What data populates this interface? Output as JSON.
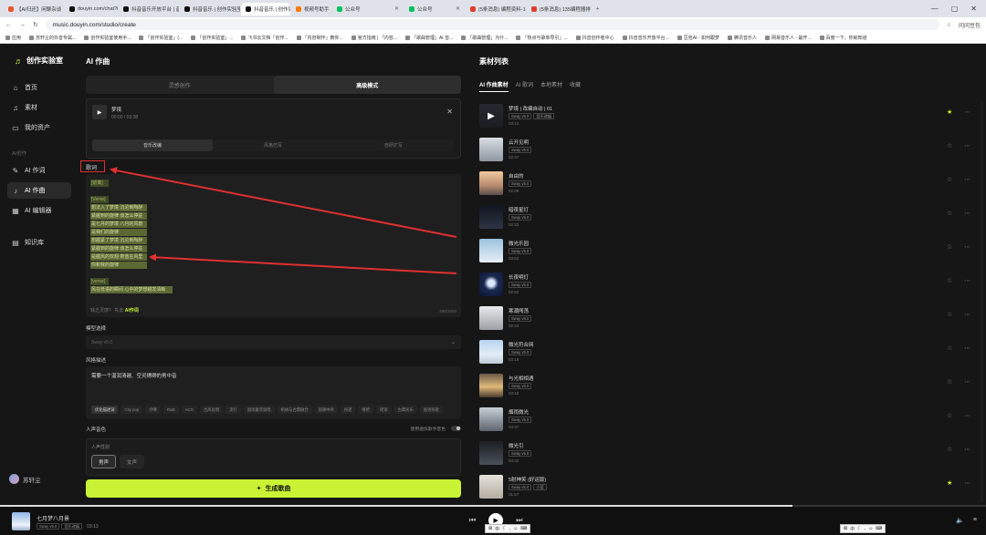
{
  "browser": {
    "tabs": [
      {
        "label": "【AI归还】闲聊杂谈",
        "color": "#e7562f"
      },
      {
        "label": "douyin.com/chat?isPc",
        "color": "#111111"
      },
      {
        "label": "抖音音乐开放平台 | 音乐",
        "color": "#111111"
      },
      {
        "label": "抖音音乐 | 创作实验室",
        "color": "#111111"
      },
      {
        "label": "抖音音乐 | 创作实验",
        "color": "#111111",
        "active": true
      },
      {
        "label": "视频号助手",
        "color": "#ff7a00"
      },
      {
        "label": "公众号",
        "color": "#07c160"
      },
      {
        "label": "公众号",
        "color": "#07c160"
      },
      {
        "label": "(5条消息) 编程资料-13",
        "color": "#e23b30"
      },
      {
        "label": "(5条消息) 135编程器排",
        "color": "#e23b30"
      }
    ],
    "url": "music.douyin.com/studio/create",
    "right_label": "问问豆包",
    "bookmarks": [
      "应用",
      "苏轩尘的抖音专属...",
      "创作实验室使用手...",
      "「创作实验室」(...",
      "「创作实验室」...",
      "飞书云文档「创作...",
      "「内容制作」教你...",
      "官方指南 | 「内容...",
      "「歌曲管理」AI 音...",
      "「歌曲管理」为什...",
      "「热点与歌单导引」...",
      "抖音创作者中心",
      "抖音音乐开放平台...",
      "豆包AI - 如何跟梦",
      "腾讯音乐人",
      "网易音乐人 - 最开...",
      "百度一下，你就知道"
    ]
  },
  "sidebar": {
    "logo": "创作实验室",
    "items": [
      {
        "label": "首页",
        "icon": "home-icon",
        "glyph": "⌂"
      },
      {
        "label": "素材",
        "icon": "music-note-icon",
        "glyph": "♫"
      },
      {
        "label": "我的资产",
        "icon": "folder-icon",
        "glyph": "▭"
      }
    ],
    "section_label": "AI创作",
    "ai_items": [
      {
        "label": "AI 作词",
        "icon": "pen-icon",
        "glyph": "✎"
      },
      {
        "label": "AI 作曲",
        "icon": "music-icon",
        "glyph": "♪",
        "selected": true
      },
      {
        "label": "AI 编辑器",
        "icon": "grid-icon",
        "glyph": "▦"
      }
    ],
    "extra_items": [
      {
        "label": "知识库",
        "icon": "book-icon",
        "glyph": "▤"
      }
    ],
    "user_name": "苏轩尘"
  },
  "center": {
    "title": "AI 作曲",
    "modes": [
      "灵感创作",
      "高级模式"
    ],
    "song": {
      "name": "梦境",
      "time": "00:00 / 03:38"
    },
    "subtabs": [
      "音乐改编",
      "风格仿写",
      "自研扩写"
    ],
    "lyrics_label": "歌词",
    "lyrics_lines": [
      {
        "text": "[前奏]",
        "type": "sec"
      },
      {
        "text": "",
        "type": "gap"
      },
      {
        "text": "[Verse]",
        "type": "sec"
      },
      {
        "text": "想法入了梦境 沉沦到陶醉",
        "type": "line"
      },
      {
        "text": "紧握到的旋律 该怎么停驻",
        "type": "line"
      },
      {
        "text": "是七月的梦境 八月的风景",
        "type": "line"
      },
      {
        "text": "是我们的旋律",
        "type": "line"
      },
      {
        "text": "想握紧了梦境 沉沦到陶醉",
        "type": "line"
      },
      {
        "text": "紧握到的旋律 该怎么停驻",
        "type": "line"
      },
      {
        "text": "是握风的双翅 蔚蓝在风里",
        "type": "line"
      },
      {
        "text": "你和我的旋律",
        "type": "line"
      },
      {
        "text": "",
        "type": "gap"
      },
      {
        "text": "[verse]",
        "type": "sec"
      },
      {
        "text": "风在低语的瞬间 心中的梦想越发清晰",
        "type": "line"
      }
    ],
    "lyrics_hint": "缺乏灵感？ 先去",
    "lyrics_hint_link": "AI作词",
    "lyrics_count": "468/2000",
    "model_label": "模型选择",
    "model_value": "Sway v5.0",
    "style_label": "风格描述",
    "style_text": "需要一个温润清越、空灵缥缈的男中音",
    "style_chips": [
      "优化描述词",
      "City pop",
      "抒情",
      "R&B",
      "ACG",
      "古风说唱",
      "流行",
      "国风童谣说唱",
      "机械与古典融合",
      "国潮中风",
      "民谣",
      "嘻哈",
      "摇滚",
      "古典民乐",
      "国语民歌"
    ],
    "voice_label": "人声音色",
    "toggle_label": "使用虚拟歌手音色",
    "gender_label": "人声性别",
    "gender_options": [
      "男声",
      "女声"
    ],
    "generate_label": "生成歌曲"
  },
  "right": {
    "title": "素材列表",
    "tabs": [
      "AI 作曲素材",
      "AI 歌词",
      "本地素材",
      "收藏"
    ],
    "items": [
      {
        "title": "梦境 | 改编自动 | 01",
        "tags": [
          "Sway v5.0",
          "音乐改编"
        ],
        "duration": "03:13",
        "fav": true,
        "thumb": "linear-gradient(180deg,#3a3f4a,#2a2e36)",
        "play": true
      },
      {
        "title": "云开见明",
        "tags": [
          "Sway v5.0"
        ],
        "duration": "02:37",
        "fav": false,
        "thumb": "linear-gradient(180deg,#d9dde3,#8f97a1)"
      },
      {
        "title": "自由的",
        "tags": [
          "Sway v5.0"
        ],
        "duration": "02:09",
        "fav": false,
        "thumb": "linear-gradient(180deg,#f1c9a0,#b78c6f 60%,#5a4d4a)"
      },
      {
        "title": "暗夜星灯",
        "tags": [
          "Sway v5.0"
        ],
        "duration": "02:32",
        "fav": false,
        "thumb": "linear-gradient(180deg,#11151e,#2e3444)"
      },
      {
        "title": "微光乐园",
        "tags": [
          "Sway v5.0"
        ],
        "duration": "03:02",
        "fav": false,
        "thumb": "linear-gradient(180deg,#9cc3e0,#e6eef5)"
      },
      {
        "title": "长夜明灯",
        "tags": [
          "Sway v5.0"
        ],
        "duration": "02:52",
        "fav": false,
        "thumb": "radial-gradient(circle at 50% 45%,#dbe8ff 0 18%,#1b2a52 40%,#0c1330)"
      },
      {
        "title": "寒潮闯荡",
        "tags": [
          "Sway v5.0"
        ],
        "duration": "02:23",
        "fav": false,
        "thumb": "linear-gradient(180deg,#e8eaec,#9aa0a6)"
      },
      {
        "title": "微光符合网",
        "tags": [
          "Sway v5.0"
        ],
        "duration": "03:18",
        "fav": false,
        "thumb": "linear-gradient(180deg,#b8d2ef,#e3edf7 60%,#c0c9d6)"
      },
      {
        "title": "与光相相遇",
        "tags": [
          "Sway v5.0"
        ],
        "duration": "03:19",
        "fav": false,
        "thumb": "linear-gradient(180deg,#6b5a48,#e0b97a 55%,#4a3b2e)"
      },
      {
        "title": "烟雨微光",
        "tags": [
          "Sway v5.0"
        ],
        "duration": "04:37",
        "fav": false,
        "thumb": "linear-gradient(180deg,#c9cfd6,#5f6670)"
      },
      {
        "title": "微光引",
        "tags": [
          "Sway v5.0"
        ],
        "duration": "04:32",
        "fav": false,
        "thumb": "linear-gradient(180deg,#1c1f24,#4a505a)"
      },
      {
        "title": "5射神笑 (好运版)",
        "tags": [
          "Sway v5.0",
          "小蓝"
        ],
        "duration": "01:57",
        "fav": true,
        "thumb": "linear-gradient(180deg,#e6e3dc,#b3aca0)"
      }
    ]
  },
  "player": {
    "title": "七月梦八月景",
    "tags": [
      "Sway v5.0",
      "音乐改编"
    ],
    "time": "03:13",
    "ime_text": "中"
  },
  "colors": {
    "accent": "#c9f334",
    "annotation": "#e03030"
  }
}
